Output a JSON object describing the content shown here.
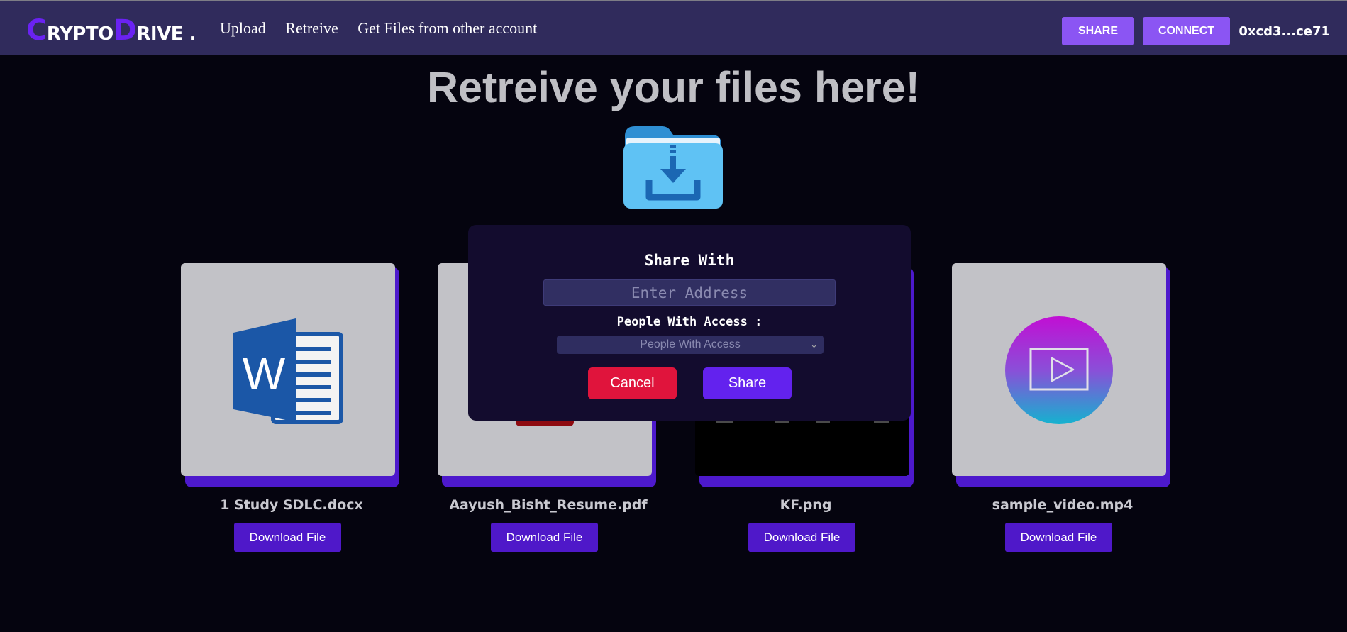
{
  "nav": {
    "brand": {
      "c1": "C",
      "rest1": "RYPTO",
      "c2": "D",
      "rest2": "RIVE",
      "dot": "."
    },
    "links": [
      "Upload",
      "Retreive",
      "Get Files from other account"
    ],
    "share_button": "SHARE",
    "connect_button": "CONNECT",
    "account": "0xcd3...ce71"
  },
  "page": {
    "title": "Retreive your files here!",
    "folder_icon": "folder-download-icon"
  },
  "files": [
    {
      "name": "1 Study SDLC.docx",
      "icon": "word-document-icon",
      "button": "Download File"
    },
    {
      "name": "Aayush_Bisht_Resume.pdf",
      "icon": "pdf-file-icon",
      "button": "Download File"
    },
    {
      "name": "KF.png",
      "icon": "image-thumbnail",
      "button": "Download File"
    },
    {
      "name": "sample_video.mp4",
      "icon": "video-play-icon",
      "button": "Download File"
    }
  ],
  "modal": {
    "title": "Share With",
    "address_placeholder": "Enter Address",
    "access_label": "People With Access :",
    "access_selected": "People With Access",
    "cancel_button": "Cancel",
    "share_button": "Share"
  },
  "colors": {
    "background": "#05040f",
    "navbar": "#302b5c",
    "accent": "#8b55f3",
    "card_shadow": "#4d19cc",
    "download_button": "#4f18c9",
    "cancel": "#e0143c",
    "share": "#6322ee"
  }
}
